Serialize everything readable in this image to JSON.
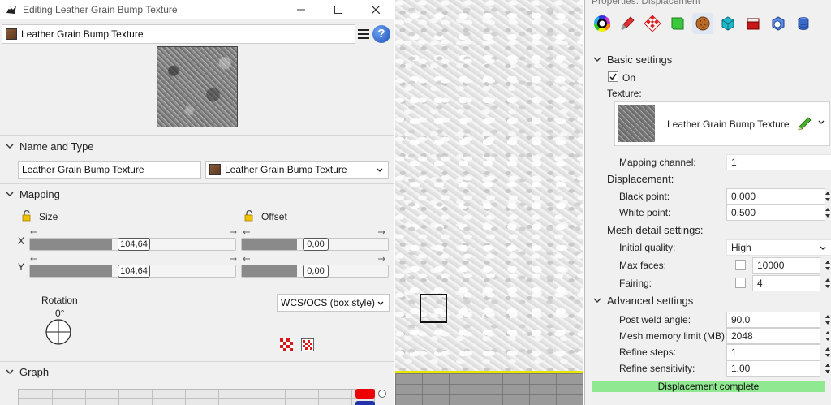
{
  "editor": {
    "title": "Editing Leather Grain Bump Texture",
    "texture_name": "Leather Grain Bump Texture",
    "sections": {
      "name_type": "Name and Type",
      "mapping": "Mapping",
      "graph": "Graph"
    },
    "name_field_value": "Leather Grain Bump Texture",
    "type_combo_value": "Leather Grain Bump Texture",
    "mapping": {
      "size_label": "Size",
      "offset_label": "Offset",
      "x_label": "X",
      "y_label": "Y",
      "size_x": "104,64",
      "size_y": "104,64",
      "offset_x": "0,00",
      "offset_y": "0,00",
      "size_fill_fraction": 0.4,
      "offset_fill_fraction": 0.38,
      "rotation_label": "Rotation",
      "rotation_value": "0°",
      "projection": "WCS/OCS (box style)"
    }
  },
  "properties": {
    "title": "Properties: Displacement",
    "icons": [
      "color-wheel-icon",
      "paint-brush-icon",
      "material-checker-icon",
      "green-square-icon",
      "ball-texture-icon",
      "teal-cube-icon",
      "red-box-icon",
      "globe-cube-icon",
      "database-icon"
    ],
    "basic_settings": "Basic settings",
    "on_label": "On",
    "on_checked": true,
    "texture_label": "Texture:",
    "texture_name": "Leather Grain Bump Texture",
    "mapping_channel_label": "Mapping channel:",
    "mapping_channel_value": "1",
    "displacement_header": "Displacement:",
    "black_point_label": "Black point:",
    "black_point_value": "0.000",
    "white_point_label": "White point:",
    "white_point_value": "0.500",
    "mesh_detail_header": "Mesh detail settings:",
    "initial_quality_label": "Initial quality:",
    "initial_quality_value": "High",
    "max_faces_label": "Max faces:",
    "max_faces_value": "10000",
    "fairing_label": "Fairing:",
    "fairing_value": "4",
    "advanced_settings": "Advanced settings",
    "post_weld_label": "Post weld angle:",
    "post_weld_value": "90.0",
    "mesh_memory_label": "Mesh memory limit (MB)",
    "mesh_memory_value": "2048",
    "refine_steps_label": "Refine steps:",
    "refine_steps_value": "1",
    "refine_sens_label": "Refine sensitivity:",
    "refine_sens_value": "1.00",
    "status": "Displacement complete"
  }
}
